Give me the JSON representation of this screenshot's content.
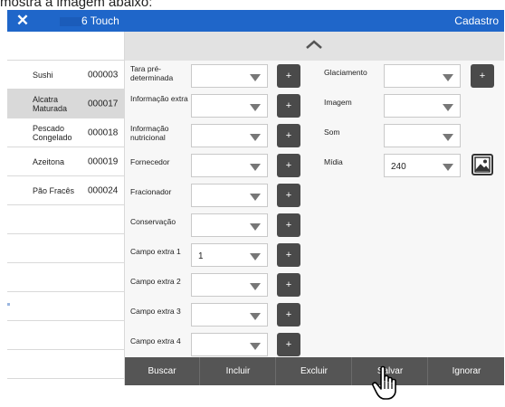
{
  "caption": "mostra a imagem abaixo:",
  "titlebar": {
    "close_glyph": "✕",
    "title": "6 Touch",
    "right": "Cadastro"
  },
  "list": {
    "items": [
      {
        "name": "Sushi",
        "code": "000003",
        "selected": false
      },
      {
        "name": "Alcatra Maturada",
        "code": "000017",
        "selected": true
      },
      {
        "name": "Pescado Congelado",
        "code": "000018",
        "selected": false
      },
      {
        "name": "Azeitona",
        "code": "000019",
        "selected": false
      },
      {
        "name": "Pão Fracês",
        "code": "000024",
        "selected": false
      }
    ]
  },
  "form": {
    "col1": [
      {
        "label": "Tara pré-determinada",
        "value": ""
      },
      {
        "label": "Informação extra",
        "value": ""
      },
      {
        "label": "Informação nutricional",
        "value": ""
      },
      {
        "label": "Fornecedor",
        "value": ""
      },
      {
        "label": "Fracionador",
        "value": ""
      },
      {
        "label": "Conservação",
        "value": ""
      },
      {
        "label": "Campo extra 1",
        "value": "1"
      },
      {
        "label": "Campo extra 2",
        "value": ""
      },
      {
        "label": "Campo extra 3",
        "value": ""
      },
      {
        "label": "Campo extra 4",
        "value": ""
      }
    ],
    "col2": [
      {
        "label": "Glaciamento",
        "value": ""
      },
      {
        "label": "Imagem",
        "value": ""
      },
      {
        "label": "Som",
        "value": ""
      },
      {
        "label": "Mídia",
        "value": "240"
      }
    ],
    "plus_label": "+"
  },
  "buttons": {
    "buscar": "Buscar",
    "incluir": "Incluir",
    "excluir": "Excluir",
    "salvar": "Salvar",
    "ignorar": "Ignorar"
  },
  "colors": {
    "titlebar": "#1f66c9",
    "button_bar": "#555555",
    "plus_button": "#4a4a4a",
    "selected_row": "#d9d9d9"
  },
  "icons": {
    "close": "close-icon",
    "collapse": "chevron-up-icon",
    "dropdown": "dropdown-arrow-icon",
    "image": "image-icon",
    "cursor": "hand-pointer-icon"
  }
}
